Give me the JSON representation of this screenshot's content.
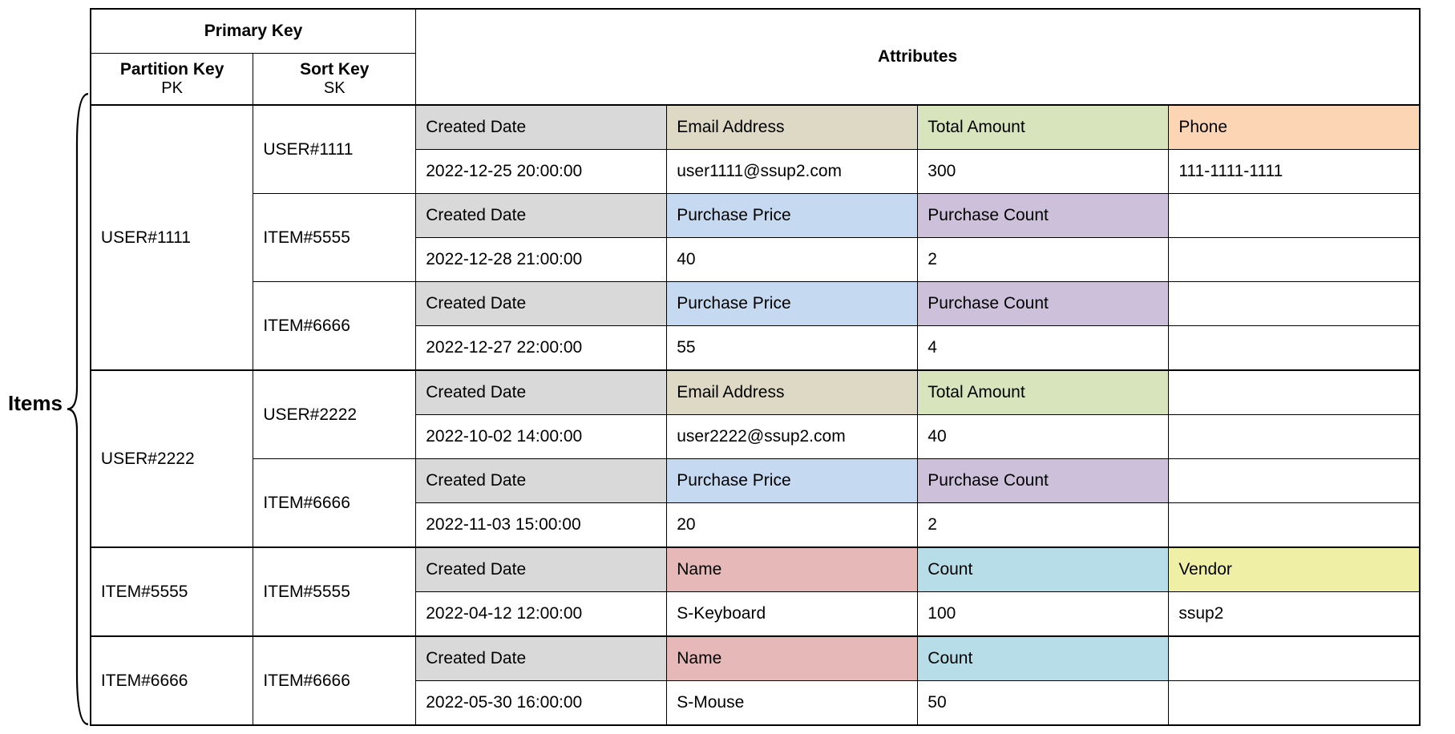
{
  "labels": {
    "items": "Items",
    "primary_key": "Primary Key",
    "attributes": "Attributes",
    "partition_key": "Partition Key",
    "partition_key_sub": "PK",
    "sort_key": "Sort Key",
    "sort_key_sub": "SK"
  },
  "attr_names": {
    "created_date": "Created Date",
    "email_address": "Email Address",
    "total_amount": "Total Amount",
    "phone": "Phone",
    "purchase_price": "Purchase Price",
    "purchase_count": "Purchase Count",
    "name": "Name",
    "count": "Count",
    "vendor": "Vendor"
  },
  "rows": [
    {
      "pk": "USER#1111",
      "items": [
        {
          "sk": "USER#1111",
          "attrs": [
            "created_date",
            "email_address",
            "total_amount",
            "phone"
          ],
          "colors": [
            "grey",
            "tan",
            "green",
            "orange"
          ],
          "values": [
            "2022-12-25 20:00:00",
            "user1111@ssup2.com",
            "300",
            "111-1111-1111"
          ]
        },
        {
          "sk": "ITEM#5555",
          "attrs": [
            "created_date",
            "purchase_price",
            "purchase_count",
            ""
          ],
          "colors": [
            "grey",
            "blue",
            "purple",
            ""
          ],
          "values": [
            "2022-12-28 21:00:00",
            "40",
            "2",
            ""
          ]
        },
        {
          "sk": "ITEM#6666",
          "attrs": [
            "created_date",
            "purchase_price",
            "purchase_count",
            ""
          ],
          "colors": [
            "grey",
            "blue",
            "purple",
            ""
          ],
          "values": [
            "2022-12-27 22:00:00",
            "55",
            "4",
            ""
          ]
        }
      ]
    },
    {
      "pk": "USER#2222",
      "items": [
        {
          "sk": "USER#2222",
          "attrs": [
            "created_date",
            "email_address",
            "total_amount",
            ""
          ],
          "colors": [
            "grey",
            "tan",
            "green",
            ""
          ],
          "values": [
            "2022-10-02 14:00:00",
            "user2222@ssup2.com",
            "40",
            ""
          ]
        },
        {
          "sk": "ITEM#6666",
          "attrs": [
            "created_date",
            "purchase_price",
            "purchase_count",
            ""
          ],
          "colors": [
            "grey",
            "blue",
            "purple",
            ""
          ],
          "values": [
            "2022-11-03 15:00:00",
            "20",
            "2",
            ""
          ]
        }
      ]
    },
    {
      "pk": "ITEM#5555",
      "items": [
        {
          "sk": "ITEM#5555",
          "attrs": [
            "created_date",
            "name",
            "count",
            "vendor"
          ],
          "colors": [
            "grey",
            "red",
            "cyan",
            "yellow"
          ],
          "values": [
            "2022-04-12 12:00:00",
            "S-Keyboard",
            "100",
            "ssup2"
          ]
        }
      ]
    },
    {
      "pk": "ITEM#6666",
      "items": [
        {
          "sk": "ITEM#6666",
          "attrs": [
            "created_date",
            "name",
            "count",
            ""
          ],
          "colors": [
            "grey",
            "red",
            "cyan",
            ""
          ],
          "values": [
            "2022-05-30 16:00:00",
            "S-Mouse",
            "50",
            ""
          ]
        }
      ]
    }
  ]
}
